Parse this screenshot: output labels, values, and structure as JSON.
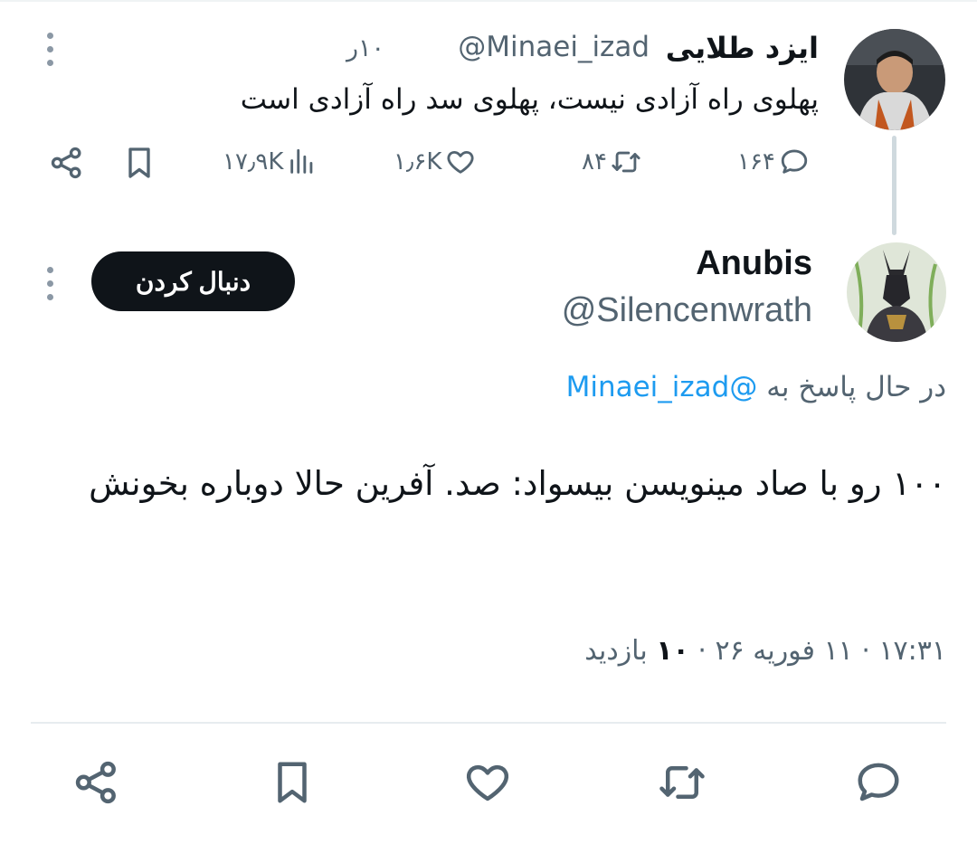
{
  "parent_tweet": {
    "author_name": "ایزد طلایی",
    "handle": "@Minaei_izad",
    "time": "۱۰ر",
    "text": "پهلوی راه آزادی نیست، پهلوی سد راه آزادی است",
    "replies": "۱۶۴",
    "retweets": "۸۴",
    "likes": "۱٫۶K",
    "views": "۱۷٫۹K"
  },
  "reply_tweet": {
    "author_name": "Anubis",
    "handle": "@Silencenwrath",
    "follow_label": "دنبال کردن",
    "replying_prefix": "در حال پاسخ به",
    "replying_to": "@Minaei_izad",
    "text": "۱۰۰ رو با صاد مینویسن بیسواد: صد. آفرین حالا دوباره بخونش",
    "time": "۱۷:۳۱",
    "date": "۱۱ فوریه ۲۶",
    "views_count": "۱۰",
    "views_label": "بازدید"
  },
  "colors": {
    "text_primary": "#0f1419",
    "text_secondary": "#536471",
    "link": "#1d9bf0",
    "follow_bg": "#0f1419"
  }
}
